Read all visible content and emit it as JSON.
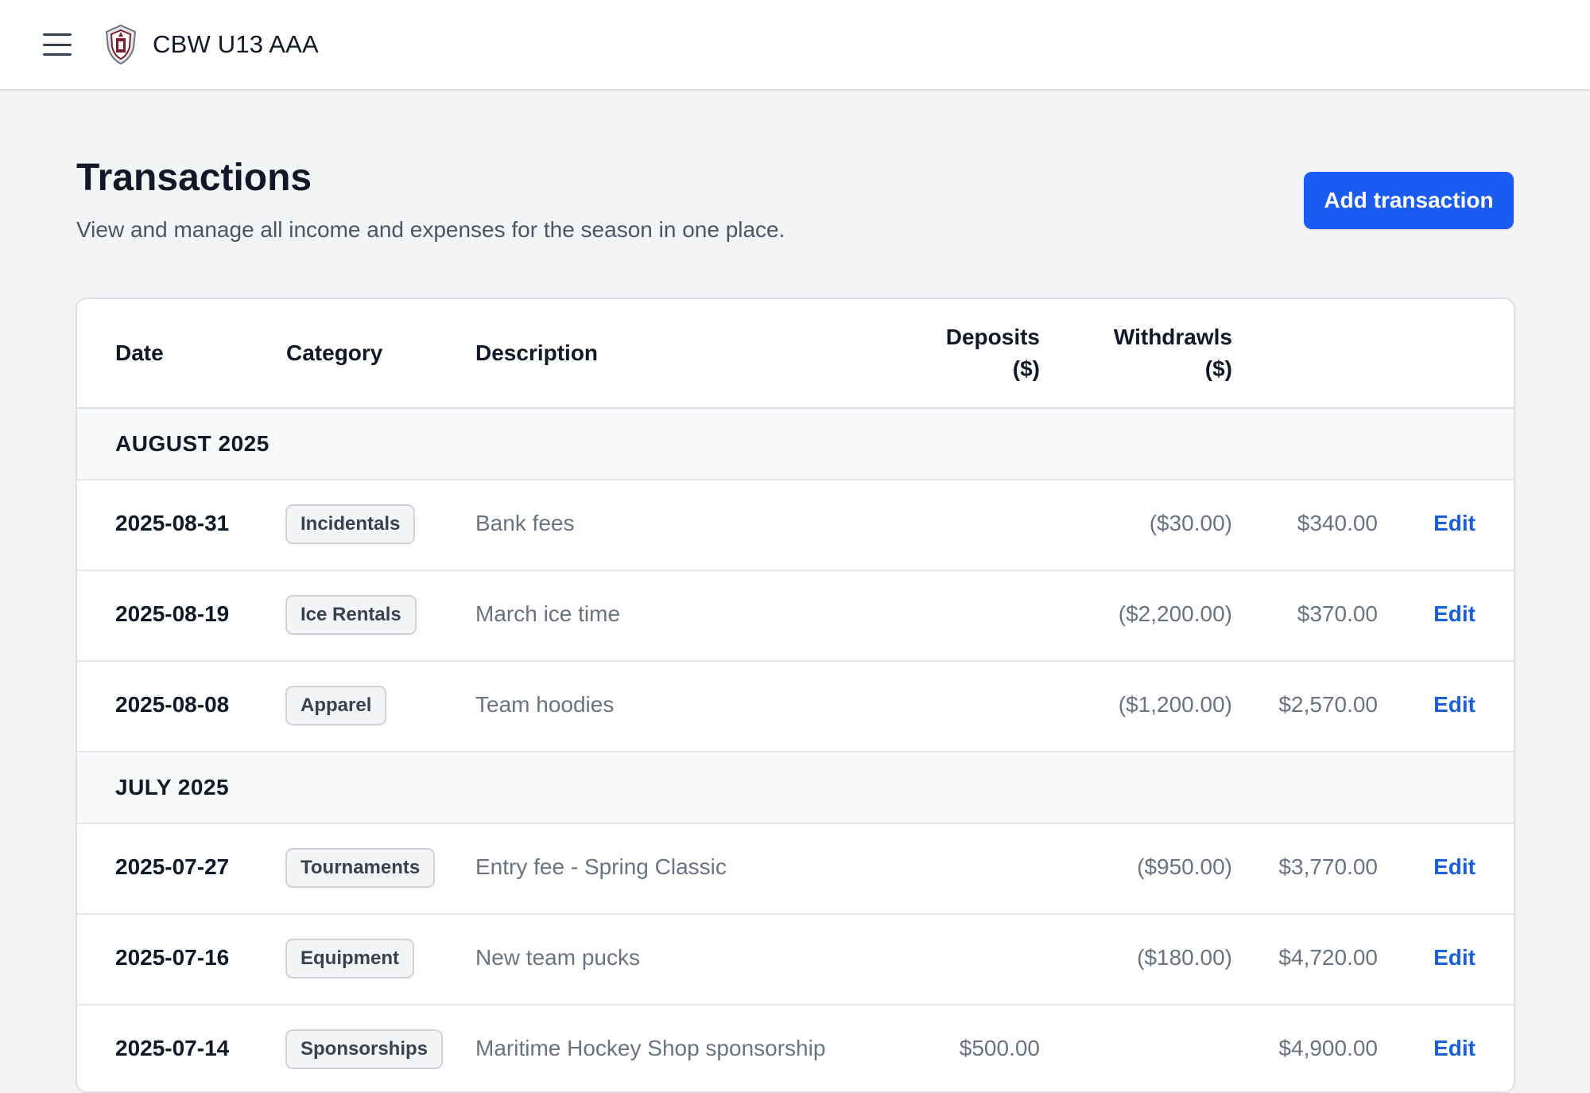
{
  "app": {
    "title": "CBW U13 AAA"
  },
  "page": {
    "title": "Transactions",
    "subtitle": "View and manage all income and expenses for the season in one place.",
    "add_button": "Add transaction"
  },
  "table": {
    "headers": {
      "date": "Date",
      "category": "Category",
      "description": "Description",
      "deposits_line1": "Deposits",
      "deposits_line2": "($)",
      "withdrawals_line1": "Withdrawls",
      "withdrawals_line2": "($)"
    },
    "edit_label": "Edit",
    "groups": [
      {
        "label": "AUGUST 2025",
        "rows": [
          {
            "date": "2025-08-31",
            "category": "Incidentals",
            "description": "Bank fees",
            "deposit": "",
            "withdrawal": "($30.00)",
            "balance": "$340.00"
          },
          {
            "date": "2025-08-19",
            "category": "Ice Rentals",
            "description": "March ice time",
            "deposit": "",
            "withdrawal": "($2,200.00)",
            "balance": "$370.00"
          },
          {
            "date": "2025-08-08",
            "category": "Apparel",
            "description": "Team hoodies",
            "deposit": "",
            "withdrawal": "($1,200.00)",
            "balance": "$2,570.00"
          }
        ]
      },
      {
        "label": "JULY 2025",
        "rows": [
          {
            "date": "2025-07-27",
            "category": "Tournaments",
            "description": "Entry fee - Spring Classic",
            "deposit": "",
            "withdrawal": "($950.00)",
            "balance": "$3,770.00"
          },
          {
            "date": "2025-07-16",
            "category": "Equipment",
            "description": "New team pucks",
            "deposit": "",
            "withdrawal": "($180.00)",
            "balance": "$4,720.00"
          },
          {
            "date": "2025-07-14",
            "category": "Sponsorships",
            "description": "Maritime Hockey Shop sponsorship",
            "deposit": "$500.00",
            "withdrawal": "",
            "balance": "$4,900.00"
          }
        ]
      }
    ]
  },
  "colors": {
    "primary": "#1a5cf2",
    "link": "#1a5fdb",
    "background": "#f3f4f6"
  }
}
